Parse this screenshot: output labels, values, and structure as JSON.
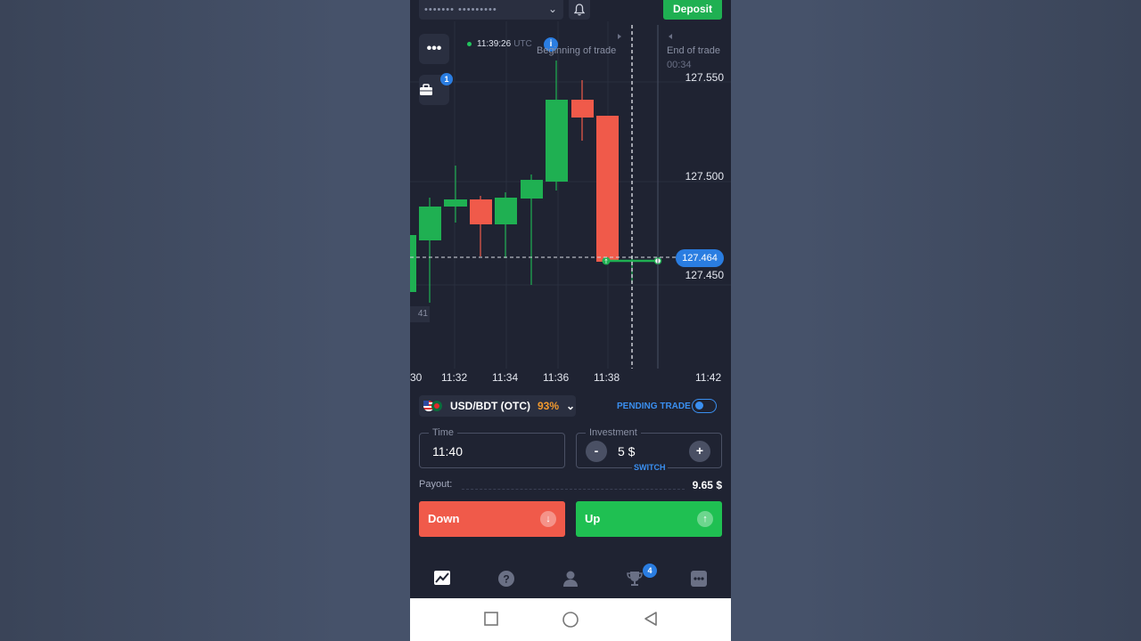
{
  "topbar": {
    "account_masked": "••••••• •••••••••",
    "deposit_label": "Deposit"
  },
  "chart": {
    "clock": "11:39:26",
    "clock_zone": "UTC",
    "beginning_label": "Beginning of trade",
    "end_label": "End of trade",
    "end_time": "00:34",
    "portfolio_badge": "1",
    "price_ticks": [
      "127.550",
      "127.500",
      "127.450"
    ],
    "current_price": "127.464",
    "left_partial_label": "41",
    "time_ticks": [
      "30",
      "11:32",
      "11:34",
      "11:36",
      "11:38",
      "11:42"
    ],
    "colors": {
      "up": "#1fb052",
      "down": "#f05a4a",
      "background": "#1f2332",
      "accent": "#2a7de1"
    }
  },
  "asset": {
    "name": "USD/BDT (OTC)",
    "payout_pct": "93%"
  },
  "pending": {
    "label": "PENDING TRADE",
    "enabled": false
  },
  "time_field": {
    "legend": "Time",
    "value": "11:40"
  },
  "investment_field": {
    "legend": "Investment",
    "value": "5 $",
    "minus": "-",
    "plus": "+",
    "switch_label": "SWITCH"
  },
  "payout": {
    "label": "Payout:",
    "value": "9.65 $"
  },
  "buttons": {
    "down_label": "Down",
    "up_label": "Up"
  },
  "nav": {
    "items": [
      "chart-icon",
      "help-icon",
      "profile-icon",
      "trophy-icon",
      "more-icon"
    ],
    "trophy_badge": "4"
  },
  "system_bar": [
    "recents-icon",
    "home-icon",
    "back-icon"
  ]
}
